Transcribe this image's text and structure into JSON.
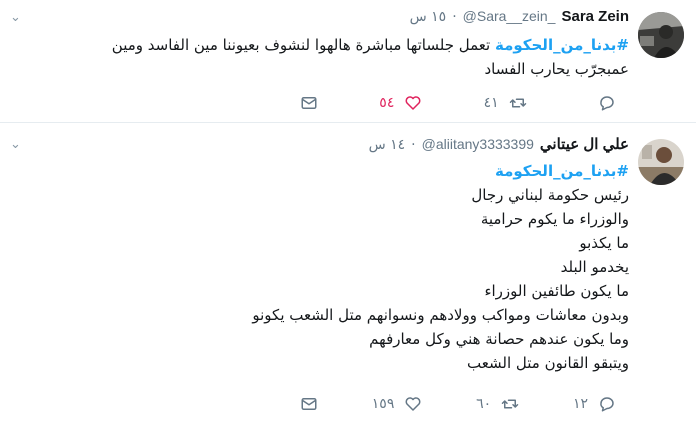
{
  "tweets": [
    {
      "fullname": "Sara Zein",
      "handle": "@Sara__zein_",
      "dot": "·",
      "time": "١٥ س",
      "hashtag": "#بدنا_من_الحكومة",
      "text_after_hashtag": " تعمل جلساتها مباشرة هالهوا لنشوف بعيوننا مين الفاسد ومين",
      "lines": [
        "عمبجرّب يحارب الفساد"
      ],
      "reply_count": "",
      "retweet_count": "٤١",
      "like_count": "٥٤",
      "liked": true,
      "avatar_desc": "person-in-car-photo"
    },
    {
      "fullname": "علي ال عيتاني",
      "handle": "@aliitany3333399",
      "dot": "·",
      "time": "١٤ س",
      "hashtag": "#بدنا_من_الحكومة",
      "lines": [
        "رئيس حكومة لبناني رجال",
        "والوزراء ما  يكوم حرامية",
        "ما يكذبو",
        "يخدمو البلد",
        "ما يكون طائفين الوزراء",
        "وبدون معاشات ومواكب وولادهم ونسوانهم متل الشعب يكونو",
        "وما يكون عندهم حصانة هني وكل معارفهم",
        "ويتبقو القانون متل الشعب"
      ],
      "reply_count": "١٢",
      "retweet_count": "٦٠",
      "like_count": "١٥٩",
      "liked": false,
      "avatar_desc": "man-seated-photo"
    }
  ],
  "colors": {
    "hashtag": "#1da1f2",
    "like_active": "#e0245e",
    "muted": "#657786"
  }
}
